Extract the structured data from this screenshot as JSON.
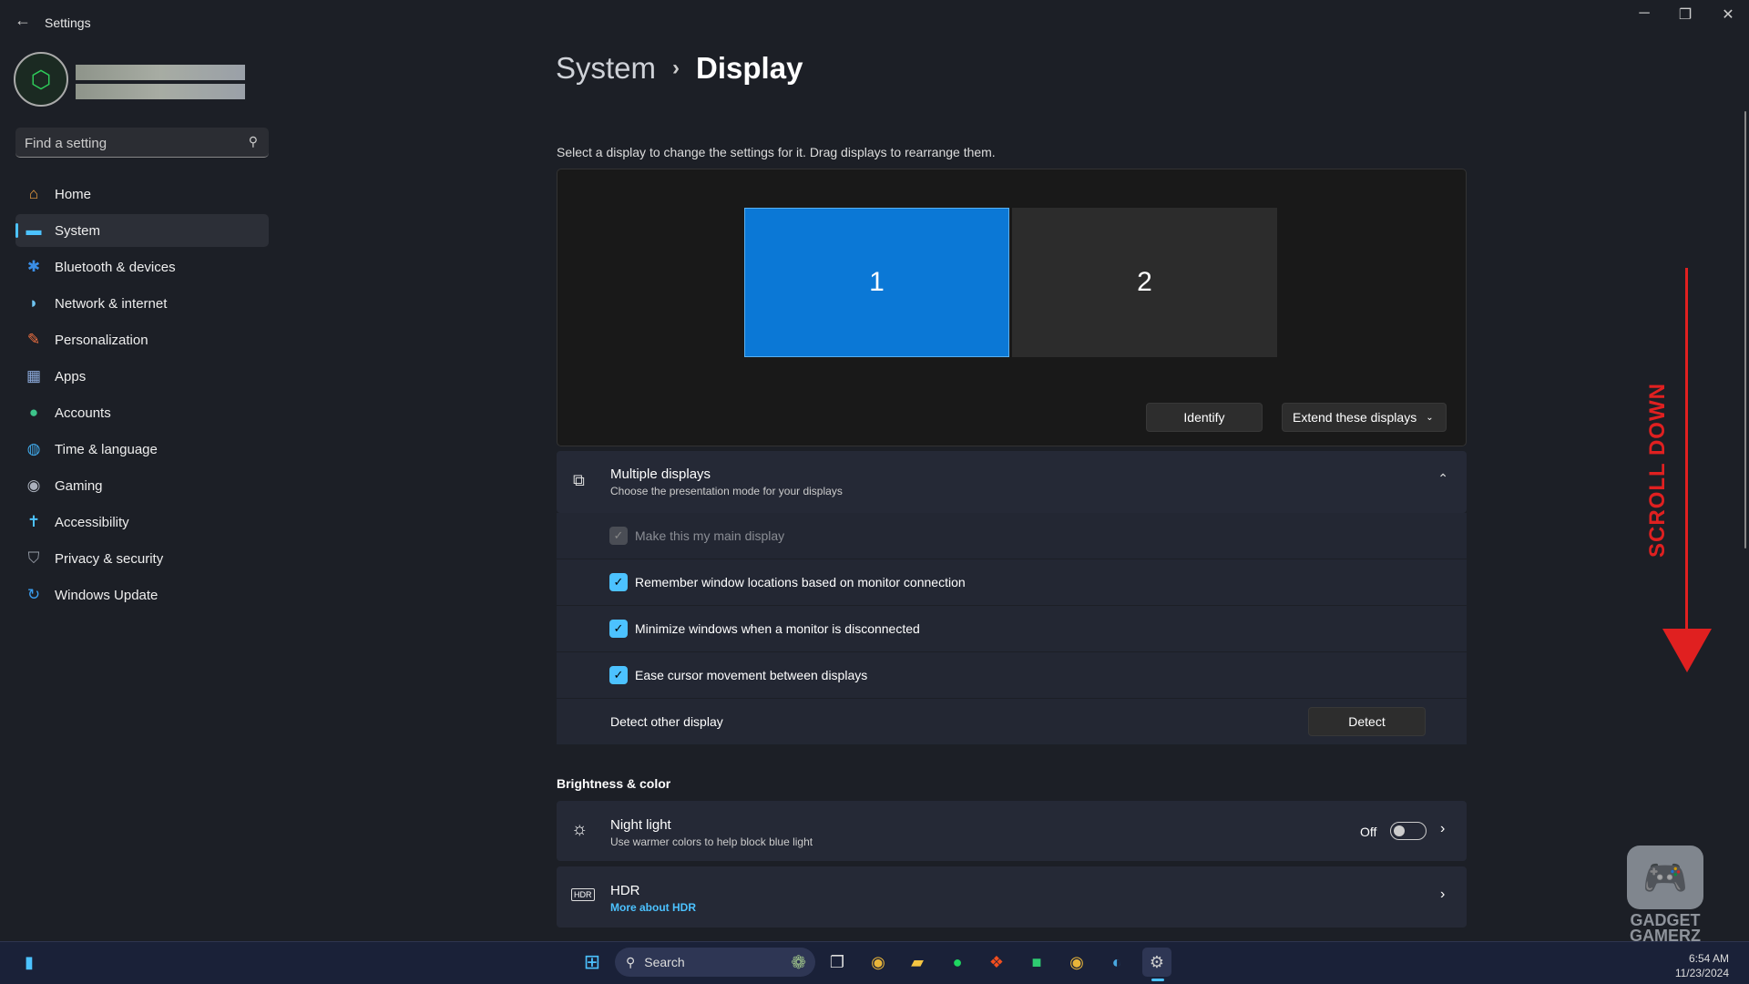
{
  "window": {
    "title": "Settings",
    "back": "←",
    "minimize": "─",
    "maximize": "❐",
    "close": "✕"
  },
  "search": {
    "placeholder": "Find a setting"
  },
  "sidebar": {
    "items": [
      {
        "label": "Home",
        "icon": "home-icon",
        "glyph": "⌂",
        "color": "#f0a040"
      },
      {
        "label": "System",
        "icon": "system-icon",
        "glyph": "▬",
        "color": "#4cc2ff"
      },
      {
        "label": "Bluetooth & devices",
        "icon": "bluetooth-icon",
        "glyph": "✱",
        "color": "#3a8ee6"
      },
      {
        "label": "Network & internet",
        "icon": "wifi-icon",
        "glyph": "◗",
        "color": "#6fc3f0"
      },
      {
        "label": "Personalization",
        "icon": "brush-icon",
        "glyph": "✎",
        "color": "#f07040"
      },
      {
        "label": "Apps",
        "icon": "apps-icon",
        "glyph": "▦",
        "color": "#8aa8d8"
      },
      {
        "label": "Accounts",
        "icon": "account-icon",
        "glyph": "●",
        "color": "#3cc48a"
      },
      {
        "label": "Time & language",
        "icon": "globe-icon",
        "glyph": "◍",
        "color": "#40a8e8"
      },
      {
        "label": "Gaming",
        "icon": "gamepad-icon",
        "glyph": "◉",
        "color": "#aab0bc"
      },
      {
        "label": "Accessibility",
        "icon": "accessibility-icon",
        "glyph": "✝",
        "color": "#4cc2ff"
      },
      {
        "label": "Privacy & security",
        "icon": "shield-icon",
        "glyph": "⛉",
        "color": "#9aa0ab"
      },
      {
        "label": "Windows Update",
        "icon": "update-icon",
        "glyph": "↻",
        "color": "#3a9ef0"
      }
    ],
    "selected": "System"
  },
  "breadcrumb": {
    "parent": "System",
    "separator": "›",
    "current": "Display"
  },
  "display": {
    "hint": "Select a display to change the settings for it. Drag displays to rearrange them.",
    "monitors": [
      "1",
      "2"
    ],
    "selected_monitor": "1",
    "identify": "Identify",
    "mode": "Extend these displays"
  },
  "multiple": {
    "title": "Multiple displays",
    "subtitle": "Choose the presentation mode for your displays",
    "options": [
      {
        "label": "Make this my main display",
        "checked": true,
        "disabled": true
      },
      {
        "label": "Remember window locations based on monitor connection",
        "checked": true
      },
      {
        "label": "Minimize windows when a monitor is disconnected",
        "checked": true
      },
      {
        "label": "Ease cursor movement between displays",
        "checked": true
      }
    ],
    "detect_label": "Detect other display",
    "detect_button": "Detect"
  },
  "brightness": {
    "heading": "Brightness & color",
    "night_light": {
      "title": "Night light",
      "subtitle": "Use warmer colors to help block blue light",
      "state": "Off"
    },
    "hdr": {
      "title": "HDR",
      "link": "More about HDR"
    }
  },
  "overlay": {
    "scroll_text": "SCROLL DOWN",
    "color": "#e02020",
    "watermark": "GADGET GAMERZ"
  },
  "taskbar": {
    "search": "Search",
    "time": "6:54 AM",
    "date": "11/23/2024"
  },
  "colors": {
    "accent": "#4cc2ff",
    "monitor_selected": "#0b78d6"
  }
}
